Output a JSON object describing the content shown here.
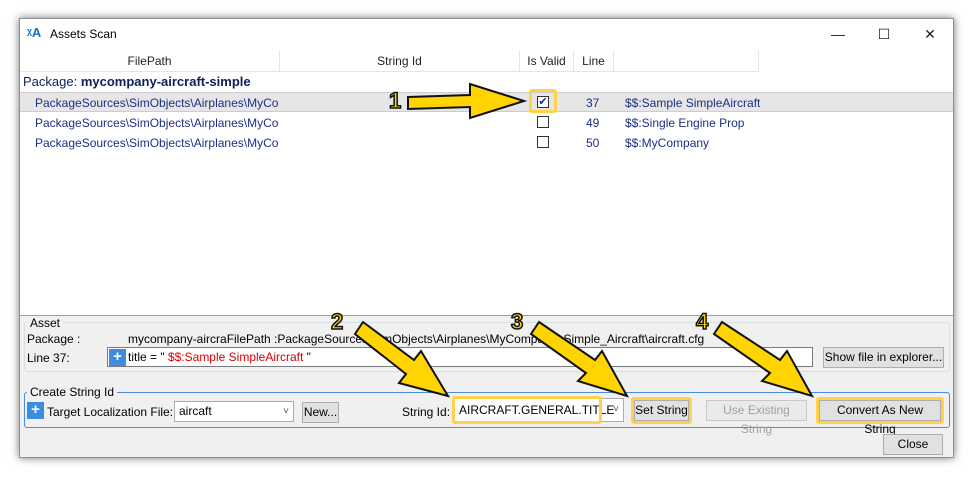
{
  "window": {
    "title": "Assets Scan",
    "minimize_glyph": "—",
    "maximize_glyph": "☐",
    "close_glyph": "✕",
    "icon": "translate-icon"
  },
  "grid": {
    "columns": [
      "FilePath",
      "String Id",
      "Is Valid",
      "Line"
    ],
    "package_label": "Package:",
    "package_name": "mycompany-aircraft-simple",
    "rows": [
      {
        "filepath": "PackageSources\\SimObjects\\Airplanes\\MyCo",
        "checked": "✔",
        "line": "37",
        "text": "$$:Sample SimpleAircraft"
      },
      {
        "filepath": "PackageSources\\SimObjects\\Airplanes\\MyCo",
        "checked": "",
        "line": "49",
        "text": "$$:Single Engine Prop"
      },
      {
        "filepath": "PackageSources\\SimObjects\\Airplanes\\MyCo",
        "checked": "",
        "line": "50",
        "text": "$$:MyCompany"
      }
    ]
  },
  "asset": {
    "group_title": "Asset",
    "package_label": "Package :",
    "package_value": "mycompany-aircraFilePath :PackageSources\\SimObjects\\Airplanes\\MyCompany_Simple_Aircraft\\aircraft.cfg",
    "line_label": "Line 37:",
    "line_prefix": "title = \" ",
    "line_highlight": "$$:Sample SimpleAircraft",
    "line_suffix": " \"",
    "plus": "+",
    "show_file_button": "Show file in explorer..."
  },
  "create": {
    "group_title": "Create String Id",
    "plus": "+",
    "target_label": "Target Localization File:",
    "target_value": "aircaft",
    "new_button": "New...",
    "string_id_label": "String Id:",
    "string_id_value": "AIRCRAFT.GENERAL.TITLE",
    "set_string_button": "Set String",
    "use_existing_button": "Use Existing String",
    "convert_button": "Convert As New String"
  },
  "close_button": "Close",
  "annotations": {
    "callouts": [
      "1",
      "2",
      "3",
      "4"
    ],
    "highlight_color": "#ffd24a",
    "arrow_fill": "#ffd400",
    "arrow_stroke": "#111111"
  }
}
